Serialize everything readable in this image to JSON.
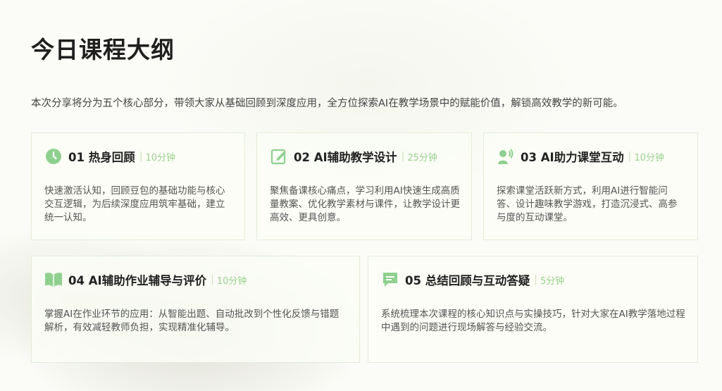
{
  "page": {
    "title": "今日课程大纲",
    "intro": "本次分享将分为五个核心部分，带领大家从基础回顾到深度应用，全方位探索AI在教学场景中的赋能价值，解锁高效教学的新可能。"
  },
  "colors": {
    "accent": "#8fd08f",
    "duration": "#9bcf8f",
    "card_border": "#e3ecd9"
  },
  "sections": [
    {
      "title": "01 热身回顾",
      "duration": "10分钟",
      "icon": "clock-icon",
      "description": "快速激活认知，回顾豆包的基础功能与核心交互逻辑，为后续深度应用筑牢基础，建立统一认知。"
    },
    {
      "title": "02 AI辅助教学设计",
      "duration": "25分钟",
      "icon": "edit-icon",
      "description": "聚焦备课核心痛点，学习利用AI快速生成高质量教案、优化教学素材与课件，让教学设计更高效、更具创意。"
    },
    {
      "title": "03 AI助力课堂互动",
      "duration": "10分钟",
      "icon": "speaker-user-icon",
      "description": "探索课堂活跃新方式，利用AI进行智能问答、设计趣味教学游戏，打造沉浸式、高参与度的互动课堂。"
    },
    {
      "title": "04 AI辅助作业辅导与评价",
      "duration": "10分钟",
      "icon": "book-icon",
      "description": "掌握AI在作业环节的应用：从智能出题、自动批改到个性化反馈与错题解析，有效减轻教师负担，实现精准化辅导。"
    },
    {
      "title": "05 总结回顾与互动答疑",
      "duration": "5分钟",
      "icon": "chat-icon",
      "description": "系统梳理本次课程的核心知识点与实操技巧，针对大家在AI教学落地过程中遇到的问题进行现场解答与经验交流。"
    }
  ]
}
